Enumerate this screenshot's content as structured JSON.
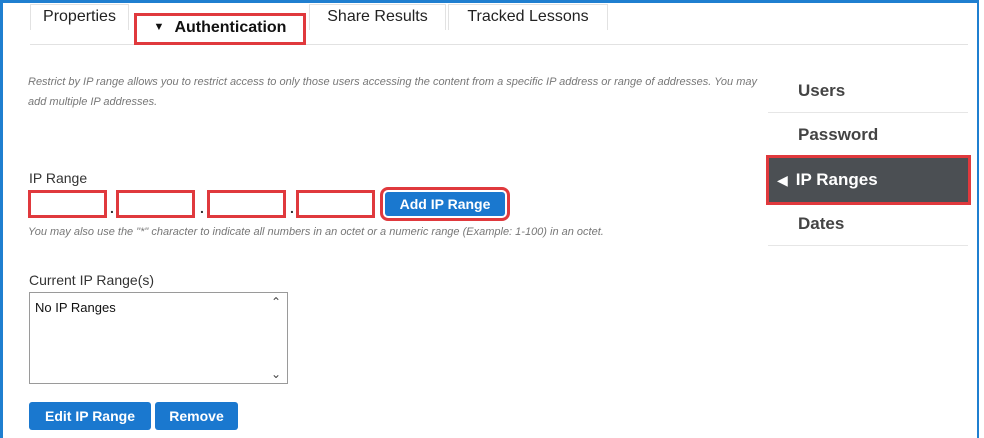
{
  "tabs": [
    {
      "label": "Properties"
    },
    {
      "label": "Authentication"
    },
    {
      "label": "Share Results"
    },
    {
      "label": "Tracked Lessons"
    }
  ],
  "description": "Restrict by IP range allows you to restrict access to only those users accessing the content from a specific IP address or range of addresses. You may add multiple IP addresses.",
  "ip_range": {
    "label": "IP Range",
    "octets": [
      "",
      "",
      "",
      ""
    ],
    "separator": ".",
    "add_button": "Add IP Range",
    "hint": "You may also use the \"*\" character to indicate all numbers in an octet or a numeric range (Example: 1-100) in an octet."
  },
  "current": {
    "label": "Current IP Range(s)",
    "items": [
      "No IP Ranges"
    ],
    "edit_button": "Edit IP Range",
    "remove_button": "Remove"
  },
  "sidebar": {
    "items": [
      {
        "label": "Users"
      },
      {
        "label": "Password"
      },
      {
        "label": "IP Ranges",
        "active": true
      },
      {
        "label": "Dates"
      }
    ]
  },
  "colors": {
    "accent": "#1a78cf",
    "highlight": "#e0393d",
    "active_bg": "#4b4f53"
  }
}
